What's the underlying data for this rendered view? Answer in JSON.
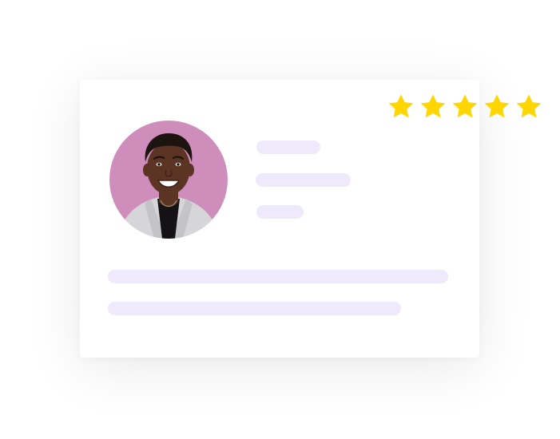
{
  "profile_card": {
    "avatar_icon": "person-avatar-icon",
    "star_icon": "star-icon",
    "rating": {
      "value": 5,
      "max": 5
    }
  },
  "colors": {
    "card_background": "#ffffff",
    "avatar_background": "#cf8dbc",
    "placeholder_bar": "#efeafb",
    "star": "#ffd600",
    "skin": "#5b3424",
    "hair": "#1d1410",
    "jacket": "#d6d6d9",
    "shirt": "#141214"
  }
}
